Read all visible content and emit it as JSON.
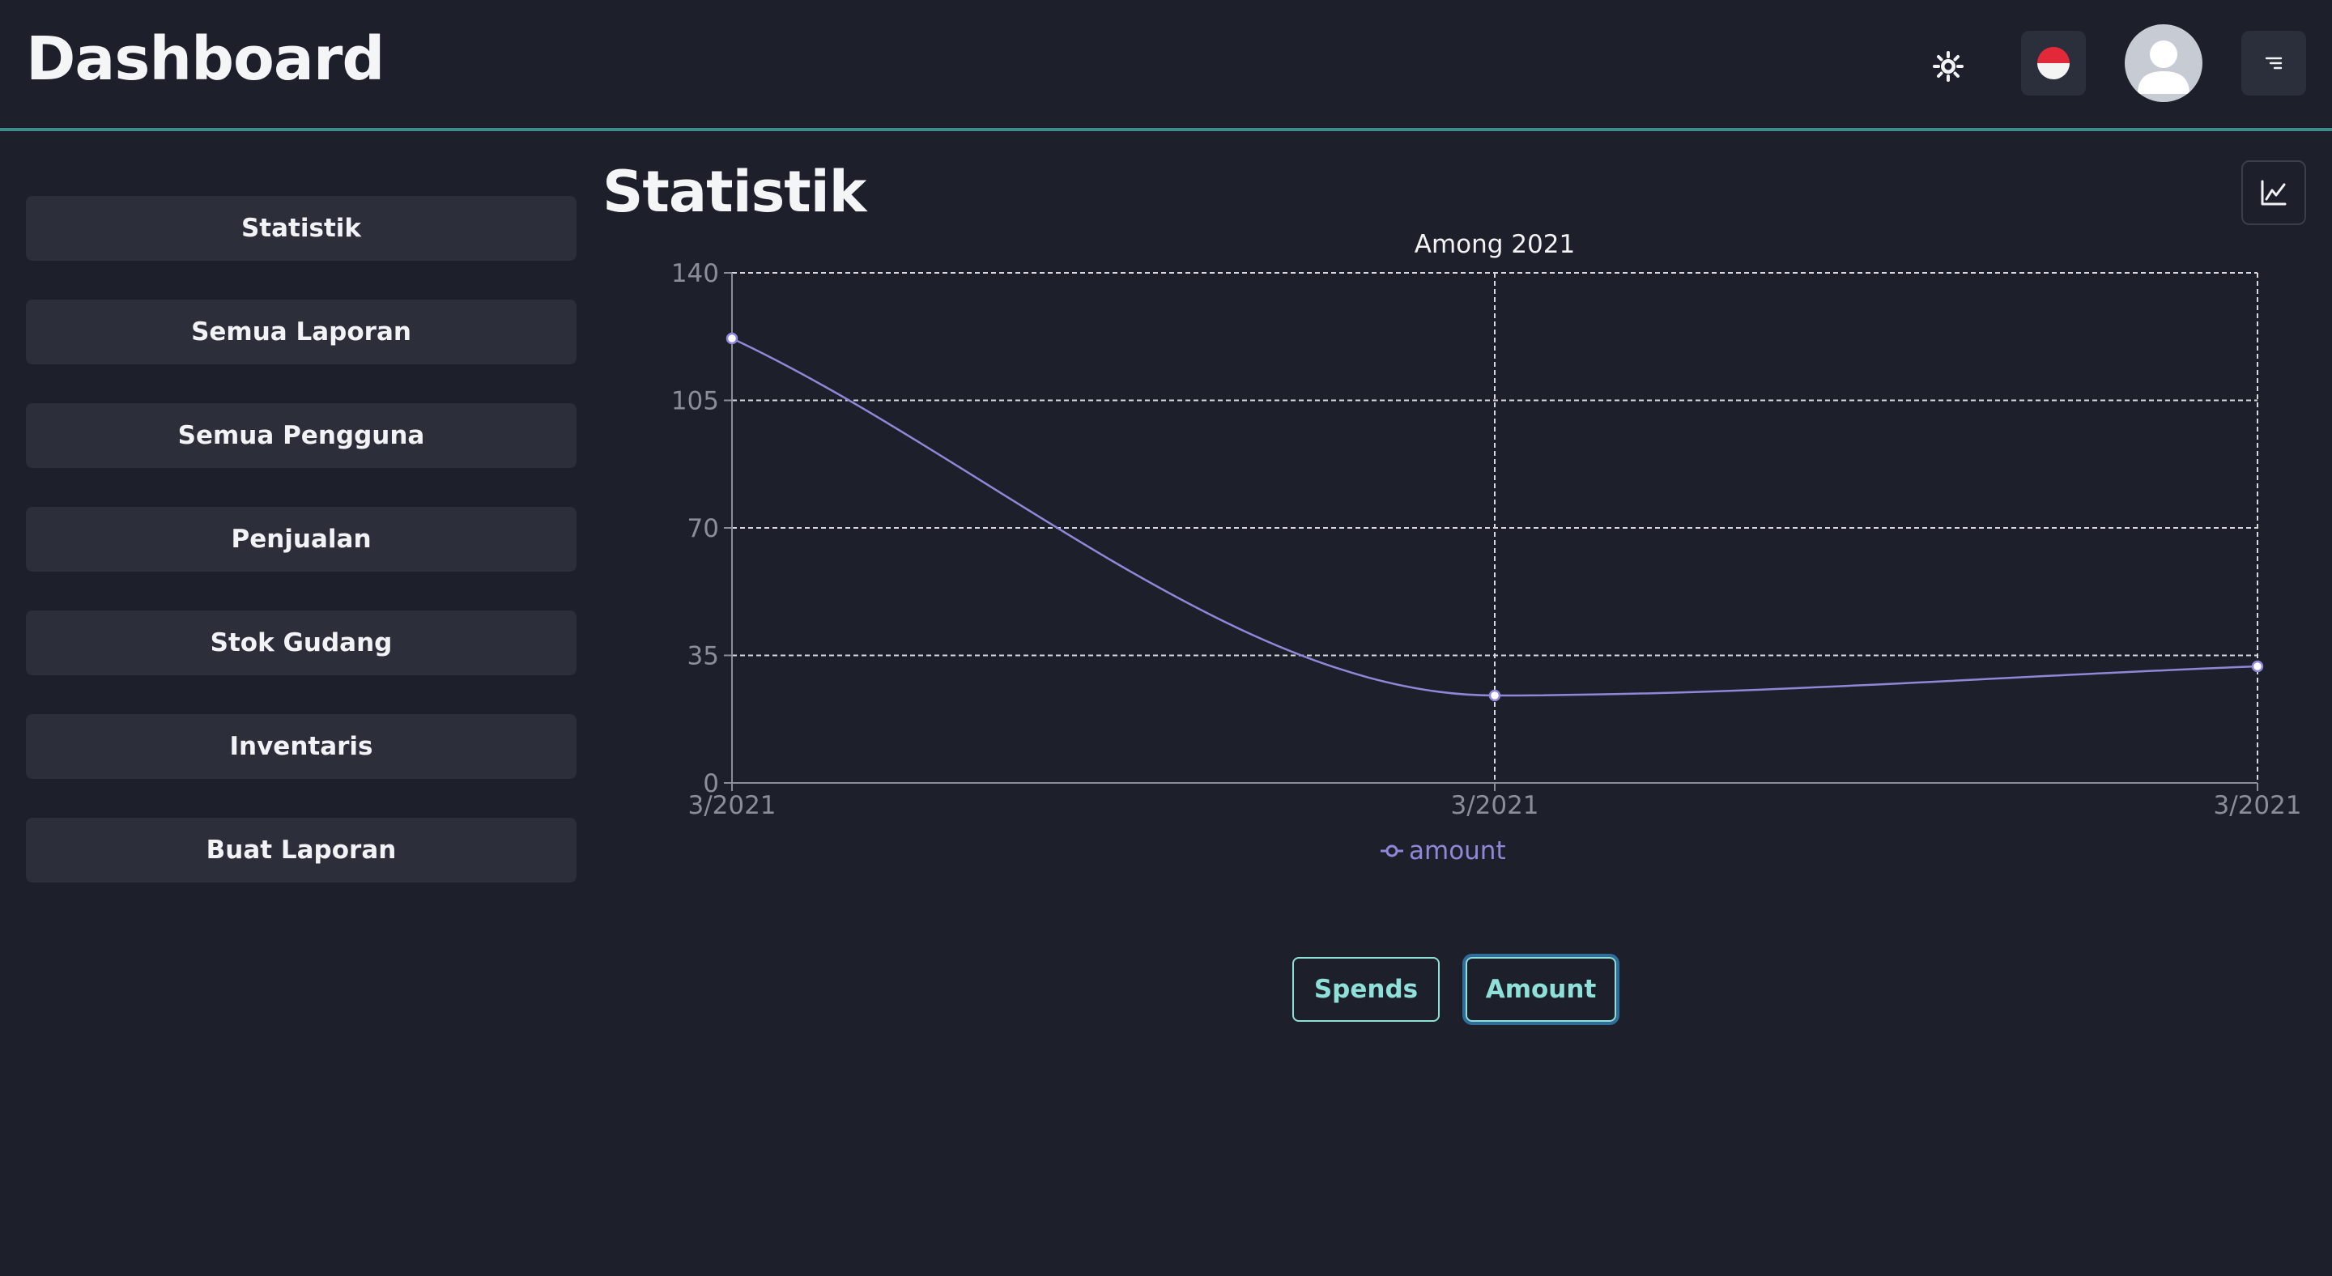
{
  "header": {
    "title": "Dashboard",
    "icons": {
      "theme": "sun-icon",
      "language": "indonesia-flag-icon",
      "avatar": "user-avatar-icon",
      "menu": "menu-icon"
    }
  },
  "sidebar": {
    "items": [
      {
        "label": "Statistik"
      },
      {
        "label": "Semua Laporan"
      },
      {
        "label": "Semua Pengguna"
      },
      {
        "label": "Penjualan"
      },
      {
        "label": "Stok Gudang"
      },
      {
        "label": "Inventaris"
      },
      {
        "label": "Buat Laporan"
      }
    ]
  },
  "main": {
    "title": "Statistik",
    "chart_toggle_icon": "line-chart-icon",
    "tabs": [
      {
        "label": "Spends"
      },
      {
        "label": "Amount",
        "active": true
      }
    ]
  },
  "colors": {
    "background": "#1d202a",
    "accent": "#8fe0d8",
    "series": "#8f88d8",
    "header_border": "#3d8c88"
  },
  "chart_data": {
    "type": "line",
    "title": "Among 2021",
    "categories": [
      "3/2021",
      "3/2021",
      "3/2021"
    ],
    "series": [
      {
        "name": "amount",
        "values": [
          122,
          24,
          32
        ]
      }
    ],
    "ylim": [
      0,
      140
    ],
    "yticks": [
      0,
      35,
      70,
      105,
      140
    ],
    "grid": true,
    "legend": "bottom",
    "curve": "smooth"
  }
}
